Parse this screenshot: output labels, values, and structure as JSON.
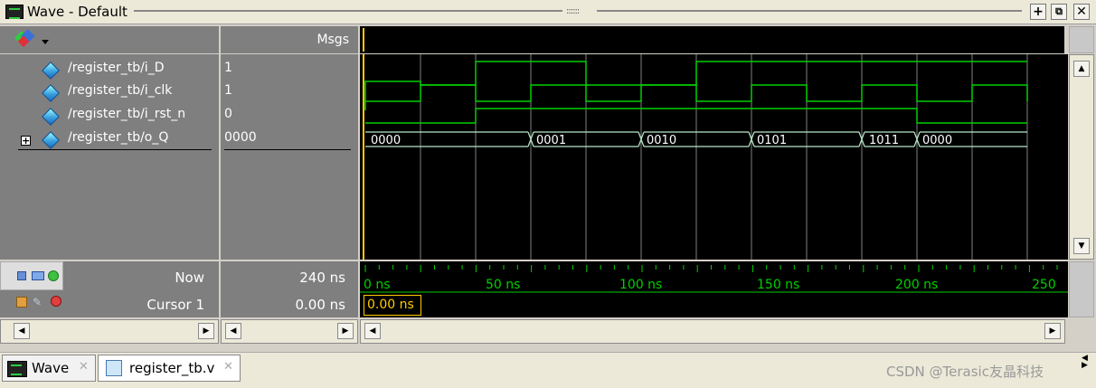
{
  "window": {
    "title": "Wave - Default"
  },
  "header": {
    "msgs_label": "Msgs"
  },
  "signals": [
    {
      "name": "/register_tb/i_D",
      "value": "1"
    },
    {
      "name": "/register_tb/i_clk",
      "value": "1"
    },
    {
      "name": "/register_tb/i_rst_n",
      "value": "0"
    },
    {
      "name": "/register_tb/o_Q",
      "value": "0000"
    }
  ],
  "bus_values": [
    "0000",
    "0001",
    "0010",
    "0101",
    "1011",
    "0000"
  ],
  "now": {
    "label": "Now",
    "value": "240 ns"
  },
  "cursor": {
    "label": "Cursor 1",
    "value": "0.00 ns",
    "marker_label": "0.00 ns"
  },
  "time_labels": [
    "0 ns",
    "50 ns",
    "100 ns",
    "150 ns",
    "200 ns",
    "250"
  ],
  "tabs": [
    {
      "label": "Wave"
    },
    {
      "label": "register_tb.v"
    }
  ],
  "watermark": "CSDN @Terasic友晶科技",
  "colors": {
    "wave": "#00d000",
    "cursor": "#ffcc00",
    "grid": "#808080"
  }
}
